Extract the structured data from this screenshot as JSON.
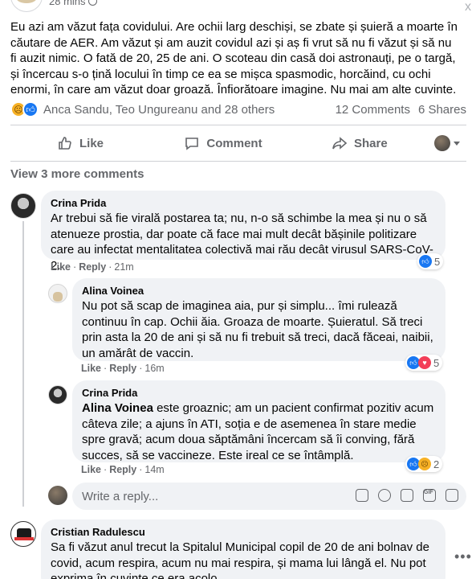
{
  "post": {
    "time": "28 mins",
    "close_label": "x",
    "text": "Eu azi am văzut fața covidului. Are ochii larg deschiși, se zbate și șuieră a moarte în căutare de AER. Am văzut și am auzit covidul azi și aș fi vrut să nu fi văzut și să nu fi auzit nimic. O fată de 20, 25 de ani. O scoteau din casă doi astronauți, pe o targă, și încercau s-o țină locului în timp ce ea se mișca spasmodic, horcăind, cu ochi enormi, în care am văzut doar groază. Înfiorătoare imagine. Nu mai am alte cuvinte."
  },
  "reactions": {
    "names": "Anca Sandu, Teo Ungureanu and 28 others",
    "comments": "12 Comments",
    "shares": "6 Shares"
  },
  "actions": {
    "like": "Like",
    "comment": "Comment",
    "share": "Share"
  },
  "view_more": "View 3 more comments",
  "comments": [
    {
      "name": "Crina Prida",
      "text": "Ar trebui să fie virală postarea ta; nu, n-o să schimbe la mea și nu o să atenueze prostia, dar poate că face mai mult decât bășinile politizare care au infectat mentalitatea colectivă mai rău decât virusul SARS-CoV-2.",
      "like": "Like",
      "reply": "Reply",
      "time": "21m",
      "reaction_count": "5"
    },
    {
      "name": "Alina Voinea",
      "text": "Nu pot să scap de imaginea aia, pur și simplu... îmi rulează continuu în cap. Ochii ăia. Groaza de moarte. Șuieratul. Să treci prin asta la 20 de ani și să nu fi trebuit să treci, dacă făceai, naibii, un amărât de vaccin.",
      "like": "Like",
      "reply": "Reply",
      "time": "16m",
      "reaction_count": "5"
    },
    {
      "name": "Crina Prida",
      "mention": "Alina Voinea",
      "text": " este groaznic; am un pacient confirmat pozitiv acum câteva zile; a ajuns în ATI, soția e de asemenea în stare medie spre gravă; acum doua săptămâni încercam să îi conving, fără succes, să se vaccineze. Este ireal ce se întâmplă.",
      "like": "Like",
      "reply": "Reply",
      "time": "14m",
      "reaction_count": "2"
    },
    {
      "name": "Cristian Radulescu",
      "text": "Sa fi văzut anul trecut la Spitalul Municipal copil de 20 de ani bolnav de covid, acum respira, acum nu mai respira, și mama lui lângă el. Nu pot exprima în cuvinte ce era acolo."
    }
  ],
  "reply_box": {
    "placeholder": "Write a reply..."
  },
  "more_label": "•••",
  "gif_label": "GIF",
  "colors": {
    "bubble": "#f0f2f5",
    "secondary_text": "#65676b",
    "like_blue": "#1877f2",
    "love_red": "#f33e58",
    "sad_yellow": "#f7b125"
  }
}
